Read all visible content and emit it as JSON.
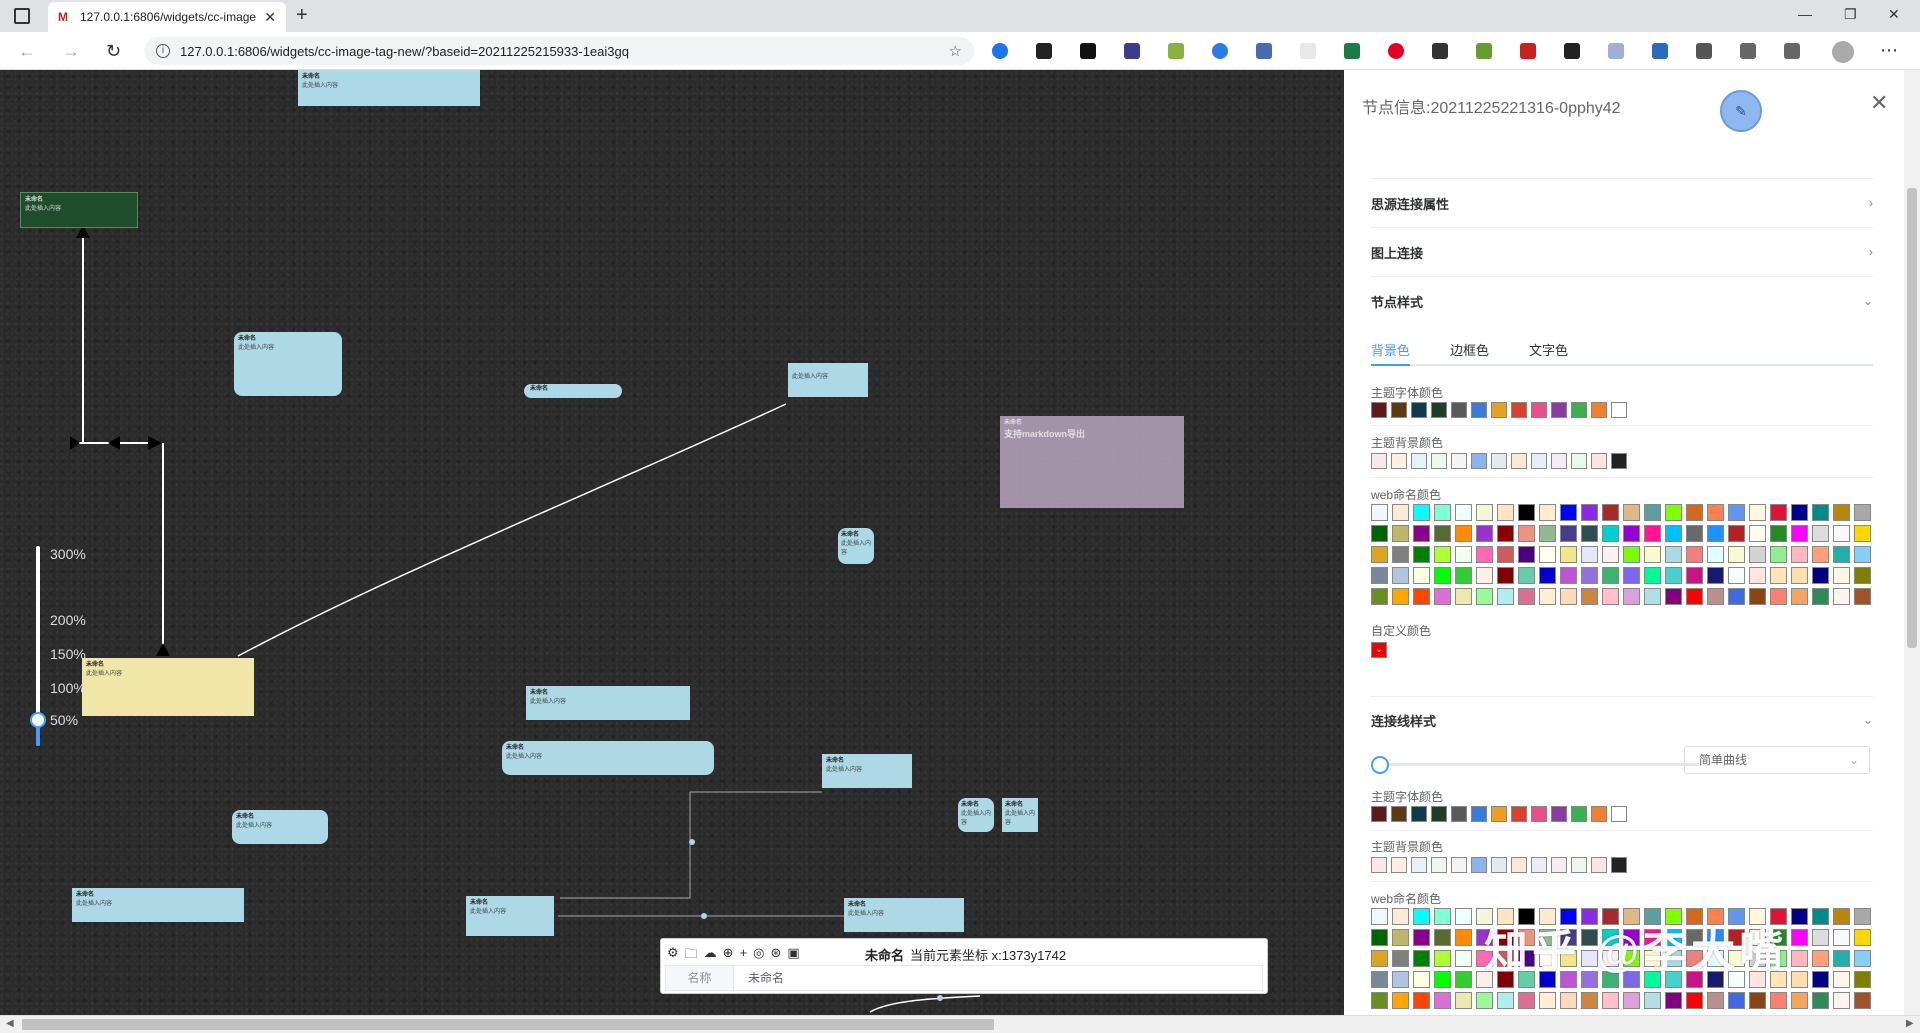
{
  "browser": {
    "tab_title": "127.0.0.1:6806/widgets/cc-image",
    "url": "127.0.0.1:6806/widgets/cc-image-tag-new/?baseid=20211225215933-1eai3gq"
  },
  "canvas": {
    "nodes": [
      {
        "title": "未命名",
        "content": "此处插入内容"
      },
      {
        "title": "未命名",
        "content": "此处插入内容"
      },
      {
        "title": "未命名",
        "content": "此处插入内容"
      },
      {
        "title": "未命名",
        "content": ""
      },
      {
        "title": "",
        "content": "此处插入内容"
      },
      {
        "title": "未命名",
        "content": "支持markdown导出"
      },
      {
        "title": "未命名",
        "content": "此处插入内容"
      },
      {
        "title": "未命名",
        "content": "此处插入内容"
      },
      {
        "title": "未命名",
        "content": "此处插入内容"
      },
      {
        "title": "未命名",
        "content": "此处插入内容"
      },
      {
        "title": "未命名",
        "content": "此处插入内容"
      },
      {
        "title": "未命名",
        "content": "此处插入内容"
      },
      {
        "title": "未命名",
        "content": "此处插入内容"
      },
      {
        "title": "未命名",
        "content": "此处插入内容"
      },
      {
        "title": "未命名",
        "content": "此处插入内容"
      },
      {
        "title": "未命名",
        "content": "此处插入内容"
      },
      {
        "title": "未命名",
        "content": "此处插入内容"
      }
    ],
    "zoom_marks": [
      "300%",
      "200%",
      "150%",
      "100%",
      "50%"
    ]
  },
  "editor": {
    "name_bold": "未命名",
    "coord_text": "当前元素坐标 x:1373y1742",
    "field_label": "名称",
    "field_value": "未命名"
  },
  "panel": {
    "header": "节点信息:20211225221316-0pphy42",
    "section_siyuan": "思源连接属性",
    "section_link": "图上连接",
    "section_style": "节点样式",
    "tabs": [
      "背景色",
      "边框色",
      "文字色"
    ],
    "theme_font_color": "主题字体颜色",
    "theme_bg_color": "主题背景颜色",
    "web_named_color": "web命名颜色",
    "custom_color": "自定义颜色",
    "section_line": "连接线样式",
    "line_type": "简单曲线",
    "watermark": "知乎 @李大嘴"
  },
  "colors": {
    "theme_font": [
      "#5c1a1a",
      "#5c3a12",
      "#0f3a4e",
      "#1e3d2b",
      "#5a5a5a",
      "#3a7bd5",
      "#e8a020",
      "#d84030",
      "#e8508a",
      "#8a3aa0",
      "#3ab050",
      "#f08030",
      "#ffffff"
    ],
    "theme_bg": [
      "#fbe6ea",
      "#fdf0e0",
      "#e8f2f6",
      "#eef6f0",
      "#f4f4f4",
      "#8ab4f0",
      "#e4eaf0",
      "#fbe8d8",
      "#e8ecfb",
      "#f8ecf4",
      "#ecf8ee",
      "#fbe4e4",
      "#222222"
    ],
    "web_named": [
      "#f0f8ff",
      "#faebd7",
      "#00ffff",
      "#7fffd4",
      "#f0ffff",
      "#f5f5dc",
      "#ffe4c4",
      "#000000",
      "#ffebcd",
      "#0000ff",
      "#8a2be2",
      "#a52a2a",
      "#deb887",
      "#5f9ea0",
      "#7fff00",
      "#d2691e",
      "#ff7f50",
      "#6495ed",
      "#fff8dc",
      "#dc143c",
      "#00008b",
      "#008b8b",
      "#b8860b",
      "#a9a9a9",
      "#006400",
      "#bdb76b",
      "#8b008b",
      "#556b2f",
      "#ff8c00",
      "#9932cc",
      "#8b0000",
      "#e9967a",
      "#8fbc8f",
      "#483d8b",
      "#2f4f4f",
      "#00ced1",
      "#9400d3",
      "#ff1493",
      "#00bfff",
      "#696969",
      "#1e90ff",
      "#b22222",
      "#fffaf0",
      "#228b22",
      "#ff00ff",
      "#dcdcdc",
      "#f8f8ff",
      "#ffd700",
      "#daa520",
      "#808080",
      "#008000",
      "#adff2f",
      "#f0fff0",
      "#ff69b4",
      "#cd5c5c",
      "#4b0082",
      "#fffff0",
      "#f0e68c",
      "#e6e6fa",
      "#fff0f5",
      "#7cfc00",
      "#fffacd",
      "#add8e6",
      "#f08080",
      "#e0ffff",
      "#fafad2",
      "#d3d3d3",
      "#90ee90",
      "#ffb6c1",
      "#ffa07a",
      "#20b2aa",
      "#87cefa",
      "#778899",
      "#b0c4de",
      "#ffffe0",
      "#00ff00",
      "#32cd32",
      "#faf0e6",
      "#800000",
      "#66cdaa",
      "#0000cd",
      "#ba55d3",
      "#9370db",
      "#3cb371",
      "#7b68ee",
      "#00fa9a",
      "#48d1cc",
      "#c71585",
      "#191970",
      "#f5fffa",
      "#ffe4e1",
      "#ffe4b5",
      "#ffdead",
      "#000080",
      "#fdf5e6",
      "#808000",
      "#6b8e23",
      "#ffa500",
      "#ff4500",
      "#da70d6",
      "#eee8aa",
      "#98fb98",
      "#afeeee",
      "#db7093",
      "#ffefd5",
      "#ffdab9",
      "#cd853f",
      "#ffc0cb",
      "#dda0dd",
      "#b0e0e6",
      "#800080",
      "#ff0000",
      "#bc8f8f",
      "#4169e1",
      "#8b4513",
      "#fa8072",
      "#f4a460",
      "#2e8b57",
      "#fff5ee",
      "#a0522d",
      "#c0c0c0",
      "#87ceeb",
      "#6a5acd",
      "#708090",
      "#fffafa",
      "#00ff7f",
      "#4682b4",
      "#d2b48c",
      "#008080",
      "#d8bfd8",
      "#ff6347",
      "#40e0d0",
      "#ee82ee",
      "#f5deb3",
      "#ffffff",
      "#f5f5f5",
      "#ffff00",
      "#9acd32"
    ],
    "web_named_b": [
      "#f0f8ff",
      "#faebd7",
      "#00ffff",
      "#7fffd4",
      "#f0ffff",
      "#f5f5dc",
      "#ffe4c4",
      "#000000",
      "#ffebcd",
      "#0000ff",
      "#8a2be2",
      "#a52a2a",
      "#deb887",
      "#5f9ea0",
      "#7fff00",
      "#d2691e",
      "#ff7f50",
      "#6495ed",
      "#fff8dc",
      "#dc143c",
      "#00008b",
      "#008b8b",
      "#b8860b",
      "#a9a9a9",
      "#006400",
      "#bdb76b",
      "#8b008b",
      "#556b2f",
      "#ff8c00",
      "#9932cc",
      "#8b0000",
      "#e9967a",
      "#8fbc8f",
      "#483d8b",
      "#2f4f4f",
      "#00ced1",
      "#9400d3",
      "#ff1493",
      "#00bfff",
      "#696969",
      "#1e90ff",
      "#b22222",
      "#fffaf0",
      "#228b22",
      "#ff00ff",
      "#dcdcdc",
      "#f8f8ff",
      "#ffd700",
      "#daa520",
      "#808080",
      "#008000",
      "#adff2f",
      "#f0fff0",
      "#ff69b4",
      "#cd5c5c",
      "#4b0082",
      "#fffff0",
      "#f0e68c",
      "#e6e6fa",
      "#fff0f5",
      "#7cfc00",
      "#fffacd",
      "#add8e6",
      "#f08080",
      "#e0ffff",
      "#fafad2",
      "#d3d3d3",
      "#90ee90",
      "#ffb6c1",
      "#ffa07a",
      "#20b2aa",
      "#87cefa",
      "#778899",
      "#b0c4de",
      "#ffffe0",
      "#00ff00",
      "#32cd32",
      "#faf0e6",
      "#800000",
      "#66cdaa",
      "#0000cd",
      "#ba55d3",
      "#9370db",
      "#3cb371",
      "#7b68ee",
      "#00fa9a",
      "#48d1cc",
      "#c71585",
      "#191970",
      "#f5fffa",
      "#ffe4e1",
      "#ffe4b5",
      "#ffdead",
      "#000080",
      "#fdf5e6",
      "#808000",
      "#6b8e23",
      "#ffa500",
      "#ff4500",
      "#da70d6",
      "#eee8aa",
      "#98fb98",
      "#afeeee",
      "#db7093",
      "#ffefd5",
      "#ffdab9",
      "#cd853f",
      "#ffc0cb",
      "#dda0dd",
      "#b0e0e6",
      "#800080",
      "#ff0000",
      "#bc8f8f",
      "#4169e1",
      "#8b4513",
      "#fa8072",
      "#f4a460",
      "#2e8b57",
      "#fff5ee",
      "#a0522d",
      "#c0c0c0",
      "#87ceeb",
      "#6a5acd",
      "#708090",
      "#fffafa",
      "#00ff7f",
      "#4682b4",
      "#d2b48c",
      "#008080",
      "#d8bfd8",
      "#ff6347",
      "#40e0d0",
      "#ee82ee",
      "#f5deb3",
      "#ffffff",
      "#f5f5f5",
      "#ffff00",
      "#9acd32"
    ],
    "accent": "#409eff"
  }
}
